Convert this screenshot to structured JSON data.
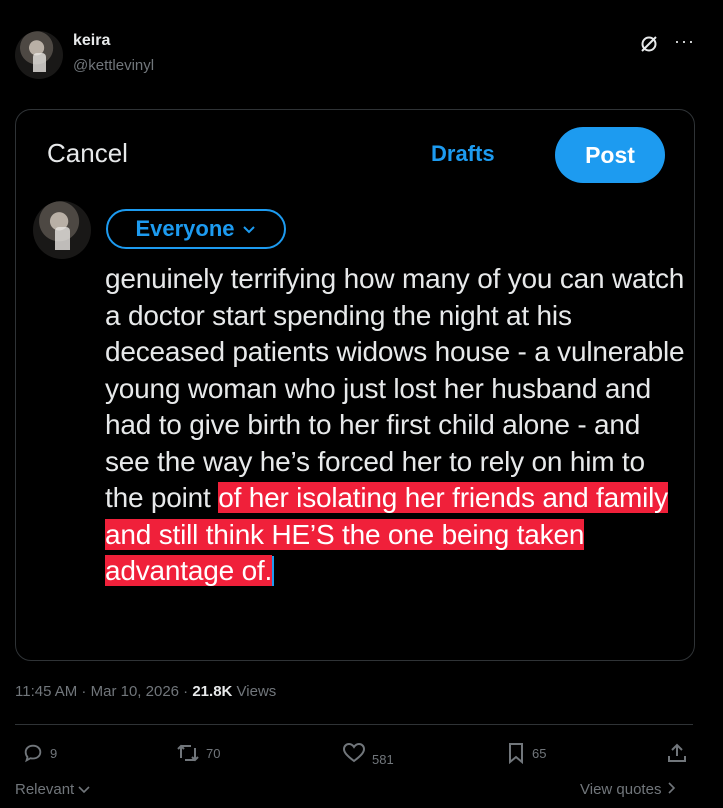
{
  "author": {
    "name": "keira",
    "handle": "@kettlevinyl"
  },
  "compose": {
    "cancel": "Cancel",
    "drafts": "Drafts",
    "post": "Post",
    "audience": "Everyone",
    "text_plain": "genuinely terrifying how many of you can watch a doctor start spending the night at his deceased patients widows house - a vulnerable young woman who just lost her husband and had to give birth to her first child alone - and see the way he’s forced her to rely on him to the point ",
    "text_highlight": "of her isolating her friends and family and still think HE’S the one being taken advantage of."
  },
  "meta": {
    "time": "11:45 AM",
    "date": "Mar 10, 2026",
    "views_count": "21.8K",
    "views_label": "Views"
  },
  "actions": {
    "replies": "9",
    "reposts": "70",
    "likes": "581",
    "bookmarks": "65"
  },
  "footer": {
    "relevant": "Relevant",
    "view_quotes": "View quotes"
  },
  "colors": {
    "accent": "#1d9bf0",
    "highlight": "#f0203a"
  }
}
